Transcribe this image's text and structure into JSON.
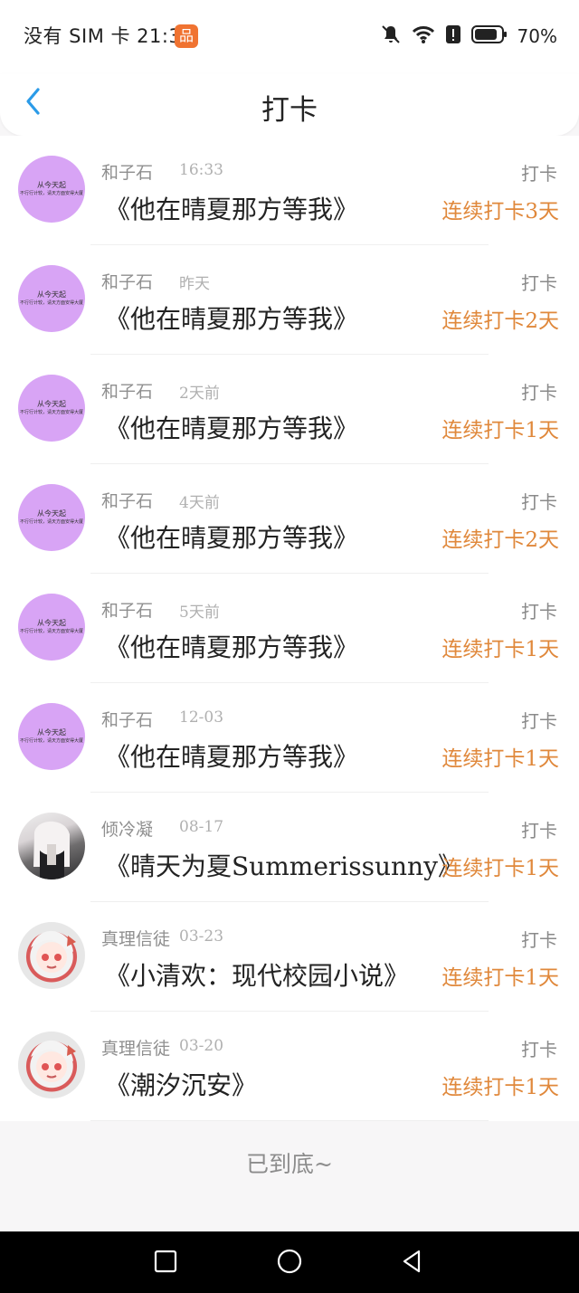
{
  "status_bar": {
    "left_text": "没有 SIM 卡 21:38",
    "app_badge": "品",
    "battery_text": "70%"
  },
  "header": {
    "title": "打卡",
    "back_icon": "chevron-left-icon",
    "accent_color": "#2b9be8"
  },
  "items": [
    {
      "avatar_type": "book-cover",
      "avatar_text_1": "从今天起",
      "avatar_text_2": "不行行计较，请天方面安得大厦",
      "username": "和子石",
      "time": "16:33",
      "book": "《他在晴夏那方等我》",
      "action": "打卡",
      "streak": "连续打卡3天"
    },
    {
      "avatar_type": "book-cover",
      "avatar_text_1": "从今天起",
      "avatar_text_2": "不行行计较，请天方面安得大厦",
      "username": "和子石",
      "time": "昨天",
      "book": "《他在晴夏那方等我》",
      "action": "打卡",
      "streak": "连续打卡2天"
    },
    {
      "avatar_type": "book-cover",
      "avatar_text_1": "从今天起",
      "avatar_text_2": "不行行计较，请天方面安得大厦",
      "username": "和子石",
      "time": "2天前",
      "book": "《他在晴夏那方等我》",
      "action": "打卡",
      "streak": "连续打卡1天"
    },
    {
      "avatar_type": "book-cover",
      "avatar_text_1": "从今天起",
      "avatar_text_2": "不行行计较，请天方面安得大厦",
      "username": "和子石",
      "time": "4天前",
      "book": "《他在晴夏那方等我》",
      "action": "打卡",
      "streak": "连续打卡2天"
    },
    {
      "avatar_type": "book-cover",
      "avatar_text_1": "从今天起",
      "avatar_text_2": "不行行计较，请天方面安得大厦",
      "username": "和子石",
      "time": "5天前",
      "book": "《他在晴夏那方等我》",
      "action": "打卡",
      "streak": "连续打卡1天"
    },
    {
      "avatar_type": "book-cover",
      "avatar_text_1": "从今天起",
      "avatar_text_2": "不行行计较，请天方面安得大厦",
      "username": "和子石",
      "time": "12-03",
      "book": "《他在晴夏那方等我》",
      "action": "打卡",
      "streak": "连续打卡1天"
    },
    {
      "avatar_type": "girl-photo",
      "username": "倾冷凝",
      "time": "08-17",
      "book": "《晴天为夏Summerissunny》",
      "action": "打卡",
      "streak": "连续打卡1天"
    },
    {
      "avatar_type": "anime-character",
      "username": "真理信徒",
      "time": "03-23",
      "book": "《小清欢：现代校园小说》",
      "action": "打卡",
      "streak": "连续打卡1天"
    },
    {
      "avatar_type": "anime-character",
      "username": "真理信徒",
      "time": "03-20",
      "book": "《潮汐沉安》",
      "action": "打卡",
      "streak": "连续打卡1天"
    }
  ],
  "end_text": "已到底~",
  "colors": {
    "streak": "#e0883b",
    "avatar_book": "#d8a4f5",
    "page_background": "#f7f6f7"
  },
  "nav": {
    "recent_icon": "square-icon",
    "home_icon": "circle-icon",
    "back_icon": "triangle-back-icon"
  }
}
